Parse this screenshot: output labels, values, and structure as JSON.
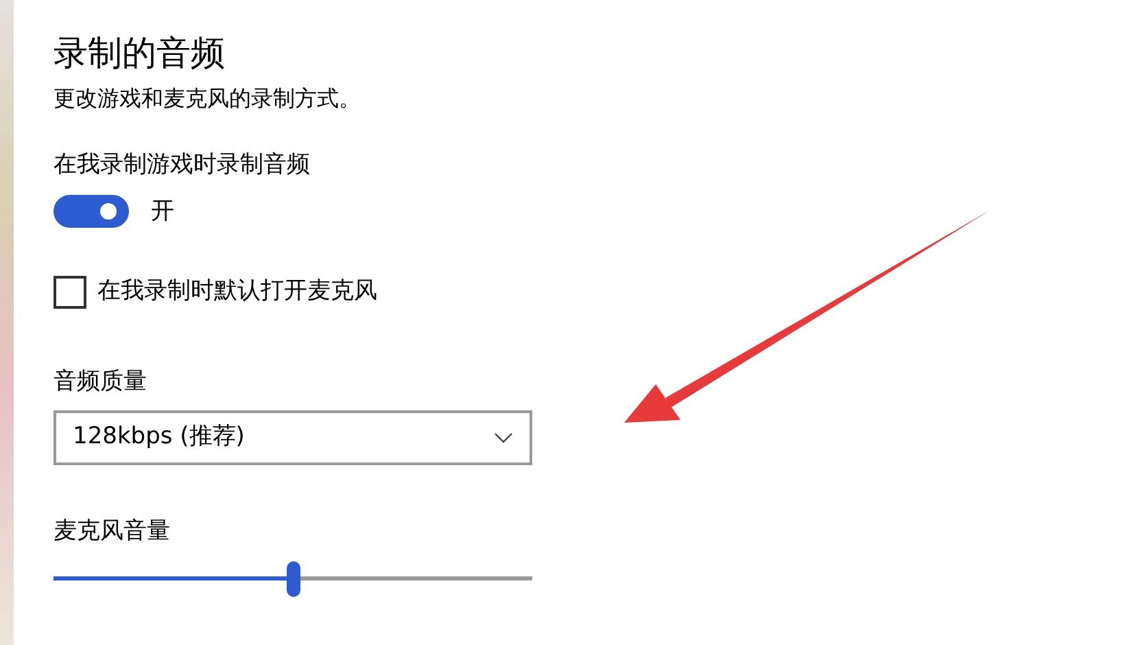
{
  "title": "录制的音频",
  "description": "更改游戏和麦克风的录制方式。",
  "record_audio": {
    "label": "在我录制游戏时录制音频",
    "on": true,
    "state_text": "开"
  },
  "mic_default": {
    "label": "在我录制时默认打开麦克风",
    "checked": false
  },
  "audio_quality": {
    "label": "音频质量",
    "value": "128kbps (推荐)"
  },
  "mic_volume": {
    "label": "麦克风音量",
    "level": 0.5
  }
}
